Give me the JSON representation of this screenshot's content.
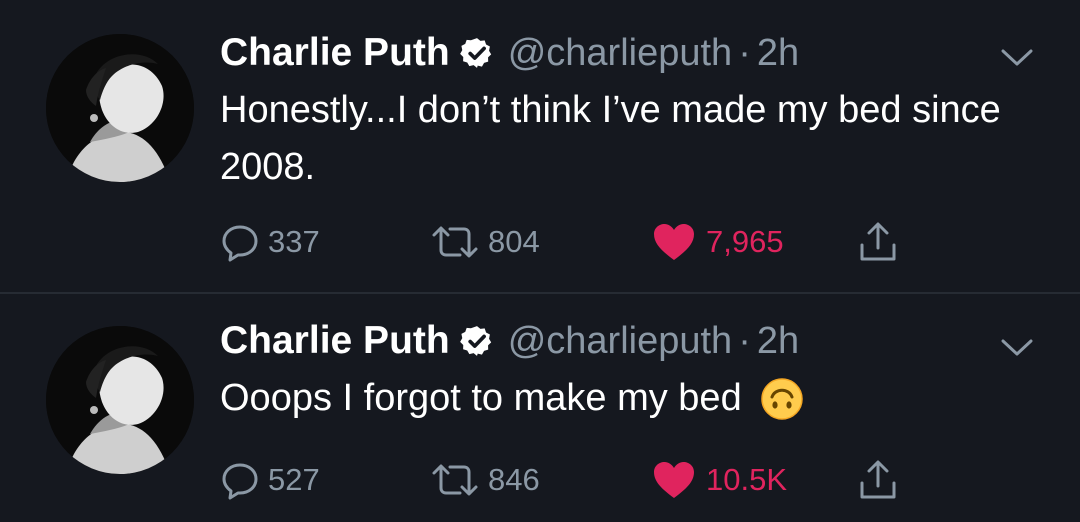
{
  "tweets": [
    {
      "name": "Charlie Puth",
      "handle": "@charlieputh",
      "separator": "·",
      "time": "2h",
      "text": "Honestly...I don’t think I’ve made my bed since 2008.",
      "emoji": "",
      "replies": "337",
      "retweets": "804",
      "likes": "7,965"
    },
    {
      "name": "Charlie Puth",
      "handle": "@charlieputh",
      "separator": "·",
      "time": "2h",
      "text": "Ooops I forgot to make my bed",
      "emoji": "upside-down-face",
      "replies": "527",
      "retweets": "846",
      "likes": "10.5K"
    }
  ],
  "colors": {
    "background": "#15181f",
    "secondary_text": "#8b98a5",
    "like": "#e0245e",
    "divider": "#262b33"
  },
  "icons": {
    "verified": "verified-badge-icon",
    "reply": "reply-icon",
    "retweet": "retweet-icon",
    "like": "heart-icon",
    "share": "share-icon",
    "menu": "chevron-down-icon"
  }
}
